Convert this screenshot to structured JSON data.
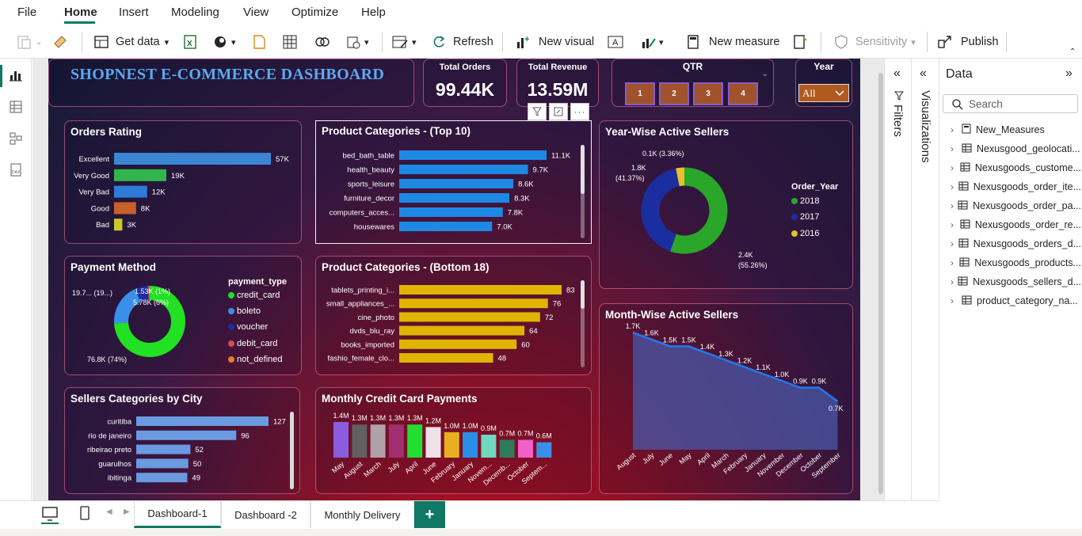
{
  "menu": {
    "file": "File",
    "home": "Home",
    "insert": "Insert",
    "modeling": "Modeling",
    "view": "View",
    "optimize": "Optimize",
    "help": "Help"
  },
  "ribbon": {
    "get_data": "Get data",
    "refresh": "Refresh",
    "new_visual": "New visual",
    "new_measure": "New measure",
    "sensitivity": "Sensitivity",
    "publish": "Publish"
  },
  "colors": {
    "accent": "#117865",
    "bar_blue": "#1e88e5",
    "bar_gold": "#e0b400",
    "donut_green": "#2fcc2f",
    "donut_navy": "#1a2ea0"
  },
  "dashboard": {
    "title": "SHOPNEST E-COMMERCE DASHBOARD",
    "kpi_orders": {
      "label": "Total Orders",
      "value": "99.44K"
    },
    "kpi_revenue": {
      "label": "Total Revenue",
      "value": "13.59M"
    },
    "qtr": {
      "label": "QTR",
      "buttons": [
        "1",
        "2",
        "3",
        "4"
      ]
    },
    "year": {
      "label": "Year",
      "selected": "All"
    }
  },
  "pane": {
    "filters": "Filters",
    "visualizations": "Visualizations",
    "data": "Data",
    "search_placeholder": "Search",
    "tables": [
      "New_Measures",
      "Nexusgood_geolocati...",
      "Nexusgoods_custome...",
      "Nexusgoods_order_ite...",
      "Nexusgoods_order_pa...",
      "Nexusgoods_order_re...",
      "Nexusgoods_orders_d...",
      "Nexusgoods_products...",
      "Nexusgoods_sellers_d...",
      "product_category_na..."
    ]
  },
  "pages": [
    "Dashboard-1",
    "Dashboard -2",
    "Monthly Delivery"
  ],
  "chart_data": [
    {
      "type": "bar",
      "title": "Orders Rating",
      "categories": [
        "Excellent",
        "Very Good",
        "Very Bad",
        "Good",
        "Bad"
      ],
      "values": [
        57,
        19,
        12,
        8,
        3
      ],
      "labels": [
        "57K",
        "19K",
        "12K",
        "8K",
        "3K"
      ],
      "colors": [
        "#3a86d4",
        "#33b54e",
        "#2f7ad9",
        "#c8602c",
        "#c8c82e"
      ]
    },
    {
      "type": "bar",
      "title": "Product Categories - (Top 10)",
      "categories": [
        "bed_bath_table",
        "health_beauty",
        "sports_leisure",
        "furniture_decor",
        "computers_acces...",
        "housewares"
      ],
      "values": [
        11.1,
        9.7,
        8.6,
        8.3,
        7.8,
        7.0
      ],
      "labels": [
        "11.1K",
        "9.7K",
        "8.6K",
        "8.3K",
        "7.8K",
        "7.0K"
      ]
    },
    {
      "type": "bar",
      "title": "Product Categories - (Bottom 18)",
      "categories": [
        "tablets_printing_i...",
        "small_appliances_...",
        "cine_photo",
        "dvds_blu_ray",
        "books_imported",
        "fashio_female_clo..."
      ],
      "values": [
        83,
        76,
        72,
        64,
        60,
        48
      ],
      "labels": [
        "83",
        "76",
        "72",
        "64",
        "60",
        "48"
      ]
    },
    {
      "type": "bar",
      "title": "Sellers Categories by City",
      "categories": [
        "curitiba",
        "rio de janeiro",
        "ribeirao preto",
        "guarulhos",
        "ibitinga"
      ],
      "values": [
        127,
        96,
        52,
        50,
        49
      ],
      "labels": [
        "127",
        "96",
        "52",
        "50",
        "49"
      ]
    },
    {
      "type": "pie",
      "title": "Payment Method",
      "legend_title": "payment_type",
      "categories": [
        "credit_card",
        "boleto",
        "voucher",
        "debit_card",
        "not_defined"
      ],
      "values": [
        74,
        19,
        6,
        1,
        0
      ],
      "colors": [
        "#22e022",
        "#3a8fe8",
        "#1a2ea0",
        "#d84a5a",
        "#e87a2a"
      ],
      "labels": [
        "76.8K (74%)",
        "19.7... (19...)",
        "5.78K (6%)",
        "1.53K (1%)"
      ]
    },
    {
      "type": "pie",
      "title": "Year-Wise Active Sellers",
      "legend_title": "Order_Year",
      "categories": [
        "2018",
        "2017",
        "2016"
      ],
      "values": [
        55.26,
        41.37,
        3.36
      ],
      "colors": [
        "#2aa62a",
        "#1a2ea0",
        "#e8c02a"
      ],
      "labels": [
        "2.4K (55.26%)",
        "1.8K (41.37%)",
        "0.1K (3.36%)"
      ]
    },
    {
      "type": "bar",
      "title": "Monthly Credit Card Payments",
      "categories": [
        "May",
        "August",
        "March",
        "July",
        "April",
        "June",
        "February",
        "January",
        "Novem...",
        "Decemb...",
        "October",
        "Septem..."
      ],
      "values": [
        1.4,
        1.3,
        1.3,
        1.3,
        1.3,
        1.2,
        1.0,
        1.0,
        0.9,
        0.7,
        0.7,
        0.6
      ],
      "labels": [
        "1.4M",
        "1.3M",
        "1.3M",
        "1.3M",
        "1.3M",
        "1.2M",
        "1.0M",
        "1.0M",
        "0.9M",
        "0.7M",
        "0.7M",
        "0.6M"
      ],
      "colors": [
        "#8a5ce0",
        "#606060",
        "#b0a0a8",
        "#a03070",
        "#22dd33",
        "#f0e0e8",
        "#e8b020",
        "#2a8ee8",
        "#70d8c0",
        "#2e7a5a",
        "#f060c8",
        "#3a8fe8"
      ]
    },
    {
      "type": "area",
      "title": "Month-Wise Active Sellers",
      "categories": [
        "August",
        "July",
        "June",
        "May",
        "April",
        "March",
        "February",
        "January",
        "November",
        "December",
        "October",
        "September"
      ],
      "values": [
        1.7,
        1.6,
        1.5,
        1.5,
        1.4,
        1.3,
        1.2,
        1.1,
        1.0,
        0.9,
        0.9,
        0.7
      ],
      "labels": [
        "1.7K",
        "1.6K",
        "1.5K",
        "1.5K",
        "1.4K",
        "1.3K",
        "1.2K",
        "1.1K",
        "1.0K",
        "0.9K",
        "0.9K",
        "0.7K"
      ]
    }
  ]
}
